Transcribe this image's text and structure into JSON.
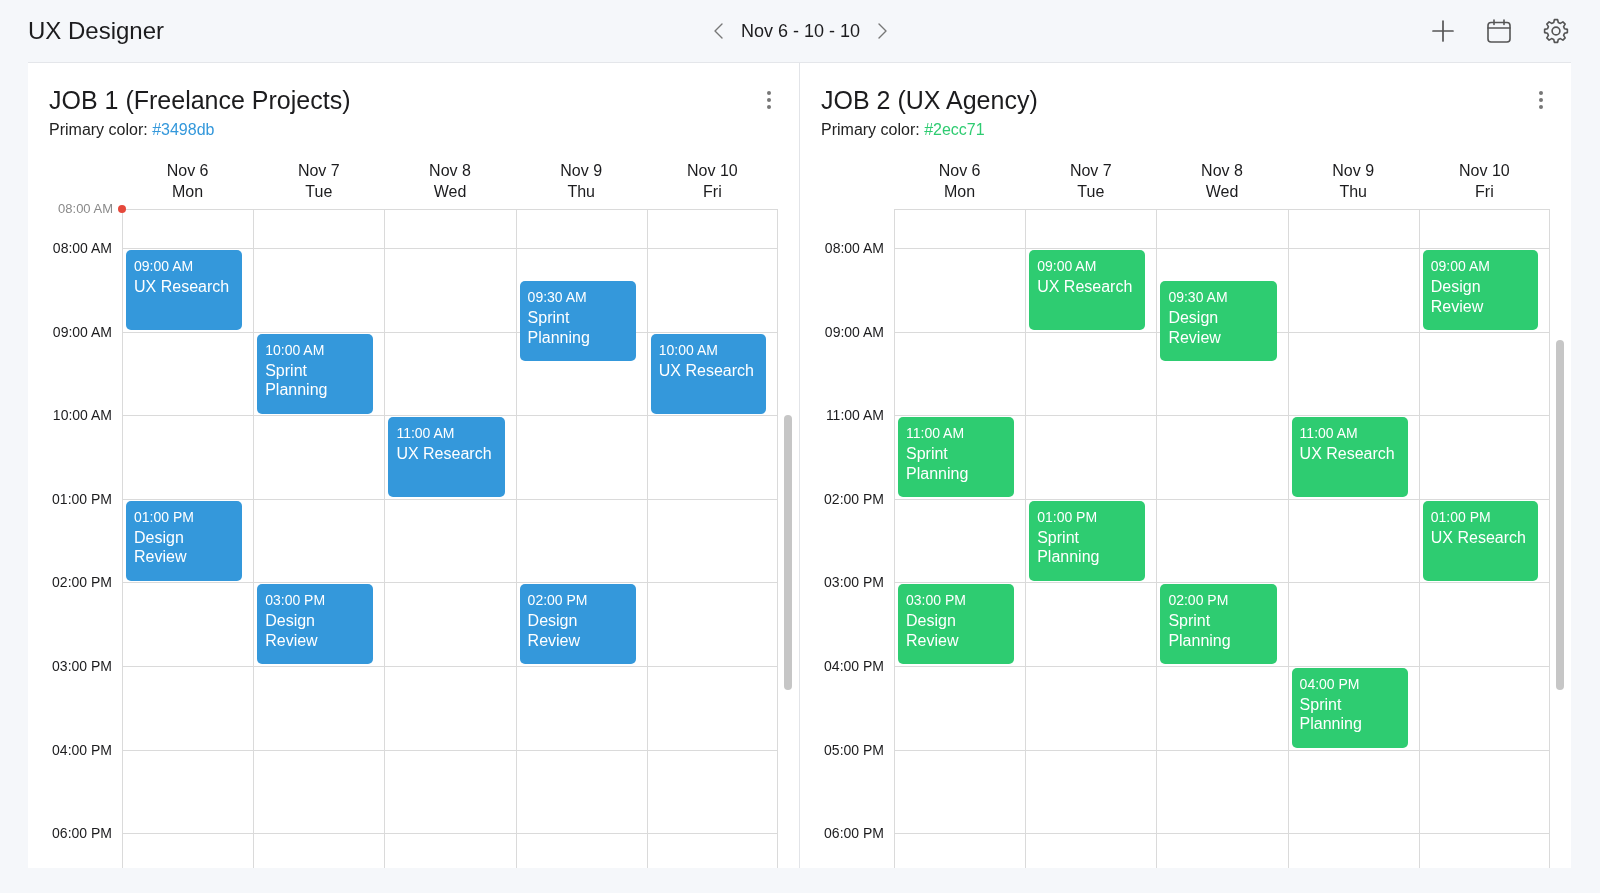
{
  "app_bar": {
    "title": "UX Designer",
    "date_range": "Nov 6 - 10 - 10"
  },
  "calendars": [
    {
      "title": "JOB 1 (Freelance Projects)",
      "color_label": "Primary color:",
      "color_text": "#3498db",
      "color": "#3498db",
      "days": [
        {
          "date": "Nov 6",
          "weekday": "Mon"
        },
        {
          "date": "Nov 7",
          "weekday": "Tue"
        },
        {
          "date": "Nov 8",
          "weekday": "Wed"
        },
        {
          "date": "Nov 9",
          "weekday": "Thu"
        },
        {
          "date": "Nov 10",
          "weekday": "Fri"
        }
      ],
      "now_marker": {
        "time": "08:00 AM"
      },
      "rows": [
        {
          "time": "08:00 AM",
          "cells": [
            {
              "event": {
                "time": "09:00 AM",
                "title": "UX Research",
                "half_past": false
              }
            },
            {},
            {},
            {
              "event": {
                "time": "09:30 AM",
                "title": "Sprint Planning",
                "half_past": true
              }
            },
            {}
          ]
        },
        {
          "time": "09:00 AM",
          "cells": [
            {},
            {
              "event": {
                "time": "10:00 AM",
                "title": "Sprint Planning",
                "half_past": false
              }
            },
            {},
            {},
            {
              "event": {
                "time": "10:00 AM",
                "title": "UX Research",
                "half_past": false
              }
            }
          ]
        },
        {
          "time": "10:00 AM",
          "cells": [
            {},
            {},
            {
              "event": {
                "time": "11:00 AM",
                "title": "UX Research",
                "half_past": false
              }
            },
            {},
            {}
          ]
        },
        {
          "time": "01:00 PM",
          "cells": [
            {
              "event": {
                "time": "01:00 PM",
                "title": "Design Review",
                "half_past": false
              }
            },
            {},
            {},
            {},
            {}
          ]
        },
        {
          "time": "02:00 PM",
          "cells": [
            {},
            {
              "event": {
                "time": "03:00 PM",
                "title": "Design Review",
                "half_past": false
              }
            },
            {},
            {
              "event": {
                "time": "02:00 PM",
                "title": "Design Review",
                "half_past": false
              }
            },
            {}
          ]
        },
        {
          "time": "03:00 PM",
          "cells": [
            {},
            {},
            {},
            {},
            {}
          ]
        },
        {
          "time": "04:00 PM",
          "cells": [
            {},
            {},
            {},
            {},
            {}
          ]
        },
        {
          "time": "06:00 PM",
          "cells": [
            {},
            {},
            {},
            {},
            {}
          ]
        }
      ]
    },
    {
      "title": "JOB 2 (UX Agency)",
      "color_label": "Primary color:",
      "color_text": "#2ecc71",
      "color": "#2ecc71",
      "days": [
        {
          "date": "Nov 6",
          "weekday": "Mon"
        },
        {
          "date": "Nov 7",
          "weekday": "Tue"
        },
        {
          "date": "Nov 8",
          "weekday": "Wed"
        },
        {
          "date": "Nov 9",
          "weekday": "Thu"
        },
        {
          "date": "Nov 10",
          "weekday": "Fri"
        }
      ],
      "rows": [
        {
          "time": "08:00 AM",
          "cells": [
            {},
            {
              "event": {
                "time": "09:00 AM",
                "title": "UX Research",
                "half_past": false
              }
            },
            {
              "event": {
                "time": "09:30 AM",
                "title": "Design Review",
                "half_past": true
              }
            },
            {},
            {
              "event": {
                "time": "09:00 AM",
                "title": "Design Review",
                "half_past": false
              }
            }
          ]
        },
        {
          "time": "09:00 AM",
          "cells": [
            {},
            {},
            {},
            {},
            {}
          ]
        },
        {
          "time": "11:00 AM",
          "cells": [
            {
              "event": {
                "time": "11:00 AM",
                "title": "Sprint Planning",
                "half_past": false
              }
            },
            {},
            {},
            {
              "event": {
                "time": "11:00 AM",
                "title": "UX Research",
                "half_past": false
              }
            },
            {}
          ]
        },
        {
          "time": "02:00 PM",
          "cells": [
            {},
            {
              "event": {
                "time": "01:00 PM",
                "title": "Sprint Planning",
                "half_past": false
              }
            },
            {},
            {},
            {
              "event": {
                "time": "01:00 PM",
                "title": "UX Research",
                "half_past": false
              }
            }
          ]
        },
        {
          "time": "03:00 PM",
          "cells": [
            {
              "event": {
                "time": "03:00 PM",
                "title": "Design Review",
                "half_past": false
              }
            },
            {},
            {
              "event": {
                "time": "02:00 PM",
                "title": "Sprint Planning",
                "half_past": false
              }
            },
            {},
            {}
          ]
        },
        {
          "time": "04:00 PM",
          "cells": [
            {},
            {},
            {},
            {
              "event": {
                "time": "04:00 PM",
                "title": "Sprint Planning",
                "half_past": false
              }
            },
            {}
          ]
        },
        {
          "time": "05:00 PM",
          "cells": [
            {},
            {},
            {},
            {},
            {}
          ]
        },
        {
          "time": "06:00 PM",
          "cells": [
            {},
            {},
            {},
            {},
            {}
          ]
        }
      ]
    }
  ]
}
